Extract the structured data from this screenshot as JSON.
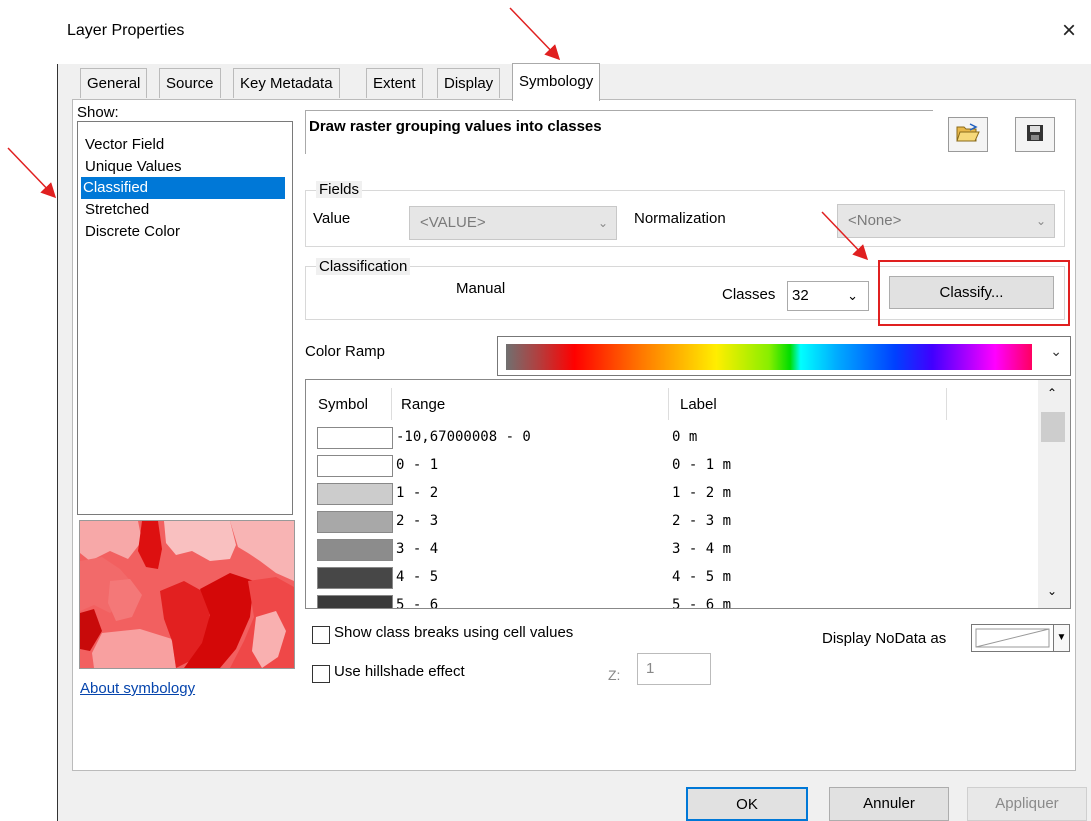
{
  "window": {
    "title": "Layer Properties",
    "close": "×"
  },
  "tabs": [
    "General",
    "Source",
    "Key Metadata",
    "Extent",
    "Display",
    "Symbology"
  ],
  "show": {
    "label": "Show:",
    "items": [
      "Vector Field",
      "Unique Values",
      "Classified",
      "Stretched",
      "Discrete Color"
    ],
    "selected": "Classified"
  },
  "about_link": "About symbology",
  "heading": "Draw raster grouping values into classes",
  "fields": {
    "group_label": "Fields",
    "value_label": "Value",
    "value_selected": "<VALUE>",
    "normalization_label": "Normalization",
    "normalization_selected": "<None>"
  },
  "classification": {
    "group_label": "Classification",
    "method": "Manual",
    "classes_label": "Classes",
    "classes_value": "32",
    "classify_button": "Classify..."
  },
  "color_ramp_label": "Color Ramp",
  "table": {
    "headers": [
      "Symbol",
      "Range",
      "Label"
    ],
    "rows": [
      {
        "range": "-10,67000008 - 0",
        "label": "0 m",
        "color": "#ffffff"
      },
      {
        "range": "0 - 1",
        "label": "0 - 1 m",
        "color": "#ffffff"
      },
      {
        "range": "1 - 2",
        "label": "1 - 2 m",
        "color": "#cccccc"
      },
      {
        "range": "2 - 3",
        "label": "2 - 3 m",
        "color": "#a8a8a8"
      },
      {
        "range": "3 - 4",
        "label": "3 - 4 m",
        "color": "#8c8c8c"
      },
      {
        "range": "4 - 5",
        "label": "4 - 5 m",
        "color": "#474747"
      },
      {
        "range": "5 - 6",
        "label": "5 - 6 m",
        "color": "#3a3a3a"
      }
    ]
  },
  "options": {
    "class_breaks": "Show class breaks using cell values",
    "hillshade": "Use hillshade effect",
    "z_label": "Z:",
    "z_value": "1",
    "nodata_label": "Display NoData as"
  },
  "buttons": {
    "ok": "OK",
    "cancel": "Annuler",
    "apply": "Appliquer"
  },
  "colors": {
    "selection": "#0078d7",
    "annotation_red": "#e02020"
  }
}
